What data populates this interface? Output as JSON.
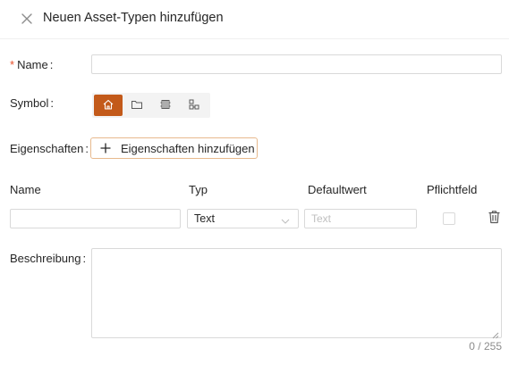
{
  "dialog": {
    "title": "Neuen Asset-Typen hinzufügen"
  },
  "form": {
    "name_label": "Name",
    "required_marker": "*",
    "symbol_label": "Symbol",
    "symbols": [
      {
        "icon": "home-icon",
        "active": true
      },
      {
        "icon": "folder-icon",
        "active": false
      },
      {
        "icon": "server-icon",
        "active": false
      },
      {
        "icon": "network-icon",
        "active": false
      }
    ],
    "properties_label": "Eigenschaften",
    "add_properties_button": "Eigenschaften hinzufügen",
    "columns": {
      "name": "Name",
      "type": "Typ",
      "default": "Defaultwert",
      "required": "Pflichtfeld"
    },
    "property_row": {
      "name_value": "",
      "type_value": "Text",
      "default_placeholder": "Text",
      "required_checked": false
    },
    "description_label": "Beschreibung",
    "description_value": "",
    "description_counter": "0 / 255"
  },
  "colors": {
    "accent": "#c35a1a",
    "accent_border": "#e7b98d",
    "required": "#e8502c",
    "border": "#d9d9d9"
  }
}
